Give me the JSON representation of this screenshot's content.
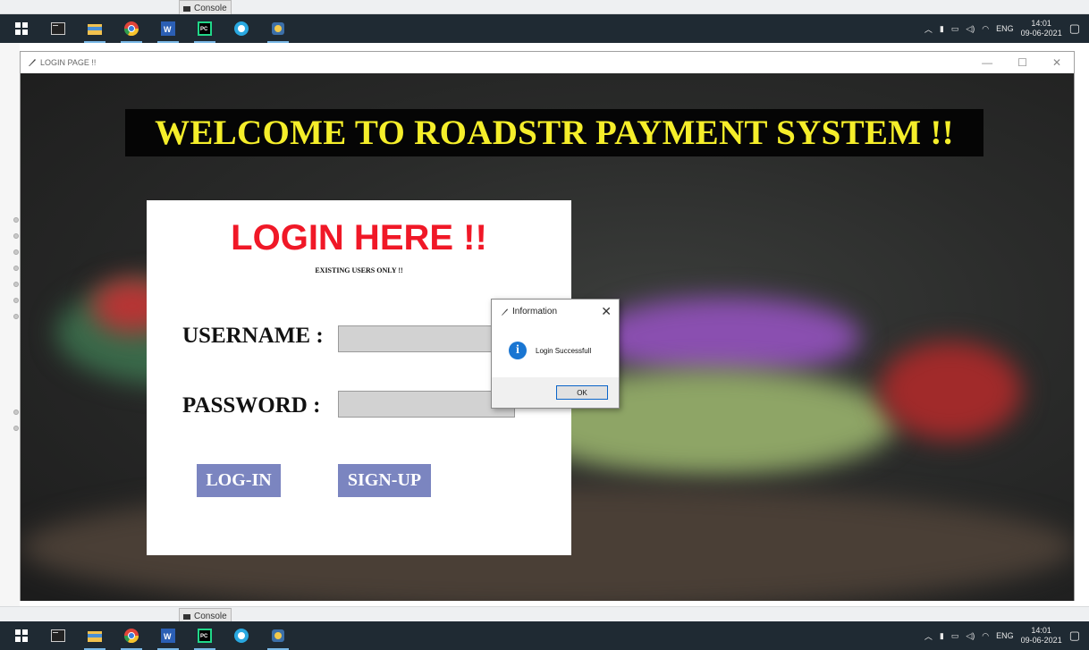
{
  "ide": {
    "console_tab_label": "Console",
    "console_tab_label_bottom": "Console"
  },
  "taskbar": {
    "tray_language": "ENG",
    "clock_time": "14:01",
    "clock_date": "09-06-2021"
  },
  "window": {
    "title": "LOGIN PAGE !!",
    "minimize": "—",
    "maximize": "☐",
    "close": "✕"
  },
  "banner": {
    "text": "WELCOME TO ROADSTR PAYMENT SYSTEM !!",
    "text_color": "#f5ee2a",
    "bg_color": "#050505"
  },
  "login": {
    "title": "LOGIN HERE !!",
    "title_color": "#f01827",
    "subtitle": "EXISTING USERS ONLY !!",
    "username_label": "USERNAME :",
    "username_value": "",
    "password_label": "PASSWORD :",
    "password_value": "",
    "login_button": "LOG-IN",
    "signup_button": "SIGN-UP",
    "button_color": "#7b85c0"
  },
  "dialog": {
    "title": "Information",
    "close": "✕",
    "message": "Login Successfull",
    "ok_label": "OK",
    "icon": "info-icon"
  }
}
